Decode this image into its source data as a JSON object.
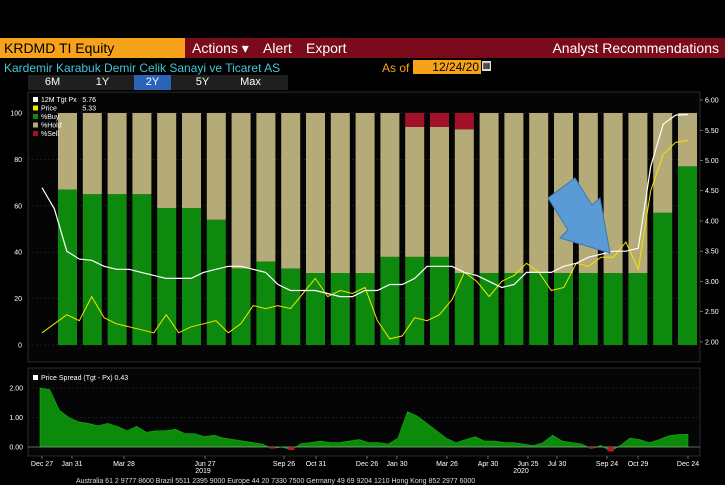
{
  "header": {
    "ticker": "KRDMD TI Equity",
    "menu": [
      "Actions ▾",
      "Alert",
      "Export"
    ],
    "function_title": "Analyst Recommendations",
    "security_name": "Kardemir Karabuk Demir Celik Sanayi ve Ticaret AS",
    "as_of_label": "As of",
    "as_of_date": "12/24/20",
    "calendar_icon": "calendar-icon"
  },
  "tabs": [
    {
      "label": "6M",
      "selected": false
    },
    {
      "label": "1Y",
      "selected": false
    },
    {
      "label": "2Y",
      "selected": true
    },
    {
      "label": "5Y",
      "selected": false
    },
    {
      "label": "Max",
      "selected": false
    }
  ],
  "colors": {
    "buy": "#0d8a0d",
    "hold": "#b5ab78",
    "sell": "#a3102a",
    "target": "#ffffff",
    "price": "#f5e400",
    "spread": "#0b8a0b",
    "menu_bar": "#7a0b1b",
    "ticker_bg": "#f7a21b"
  },
  "chart_data": [
    {
      "type": "bar",
      "left_axis": {
        "ticks": [
          "100",
          "80",
          "60",
          "40",
          "20",
          "0"
        ],
        "ylim": [
          0,
          100
        ]
      },
      "right_axis": {
        "ticks": [
          "6.00",
          "5.50",
          "5.00",
          "4.50",
          "4.00",
          "3.50",
          "3.00",
          "2.50",
          "2.00"
        ],
        "ylim": [
          1.8,
          6.05
        ]
      },
      "legend": [
        {
          "label": "12M Tgt Px",
          "value": "5.76"
        },
        {
          "label": "Price",
          "value": "5.33"
        },
        {
          "label": "%Buy",
          "value": ""
        },
        {
          "label": "%Hold",
          "value": ""
        },
        {
          "label": "%Sell",
          "value": ""
        }
      ],
      "stacked_bars": {
        "buy": [
          67,
          65,
          65,
          65,
          59,
          59,
          54,
          33,
          36,
          33,
          31,
          31,
          31,
          38,
          38,
          38,
          31,
          31,
          31,
          31,
          31,
          31,
          31,
          31,
          57,
          77
        ],
        "hold": [
          33,
          35,
          35,
          35,
          41,
          41,
          46,
          67,
          64,
          67,
          69,
          69,
          69,
          62,
          56,
          56,
          62,
          69,
          69,
          69,
          69,
          69,
          69,
          69,
          43,
          23
        ],
        "sell": [
          0,
          0,
          0,
          0,
          0,
          0,
          0,
          0,
          0,
          0,
          0,
          0,
          0,
          0,
          6,
          6,
          7,
          0,
          0,
          0,
          0,
          0,
          0,
          0,
          0,
          0
        ]
      },
      "series": [
        {
          "name": "12M Tgt Px",
          "values": [
            4.55,
            4.2,
            3.5,
            3.37,
            3.35,
            3.25,
            3.2,
            3.2,
            3.15,
            3.1,
            3.05,
            3.05,
            3.05,
            3.15,
            3.2,
            3.25,
            3.25,
            3.2,
            3.15,
            2.95,
            2.85,
            2.85,
            2.85,
            2.8,
            2.75,
            2.75,
            2.85,
            2.85,
            2.95,
            2.95,
            3.05,
            3.25,
            3.25,
            3.25,
            3.15,
            3.1,
            3.0,
            2.9,
            2.95,
            3.15,
            3.15,
            3.15,
            3.25,
            3.3,
            3.4,
            3.45,
            3.5,
            3.5,
            3.55,
            4.9,
            5.6,
            5.75,
            5.76
          ]
        },
        {
          "name": "Price",
          "values": [
            2.15,
            2.3,
            2.45,
            2.35,
            2.75,
            2.4,
            2.3,
            2.25,
            2.2,
            2.15,
            2.45,
            2.15,
            2.25,
            2.3,
            2.35,
            2.15,
            2.3,
            2.6,
            2.55,
            2.6,
            2.55,
            2.8,
            3.05,
            2.75,
            2.85,
            2.8,
            2.9,
            2.35,
            2.05,
            2.1,
            2.4,
            2.35,
            2.45,
            2.7,
            3.15,
            3.0,
            2.75,
            3.0,
            3.1,
            3.3,
            3.15,
            2.85,
            2.9,
            3.3,
            3.25,
            3.4,
            3.4,
            3.65,
            3.2,
            4.5,
            5.1,
            5.3,
            5.33
          ]
        }
      ]
    },
    {
      "type": "area",
      "legend": [
        {
          "label": "Price Spread (Tgt - Px)",
          "value": "0.43"
        }
      ],
      "y_ticks": [
        "2.00",
        "1.00",
        "0.00"
      ],
      "ylim": [
        -0.35,
        2.05
      ],
      "series": [
        {
          "name": "Price Spread (Tgt - Px)",
          "values": [
            2.0,
            1.95,
            1.25,
            1.0,
            0.85,
            0.8,
            0.72,
            0.8,
            0.7,
            0.55,
            0.7,
            0.5,
            0.55,
            0.55,
            0.6,
            0.45,
            0.45,
            0.35,
            0.4,
            0.3,
            0.25,
            0.2,
            0.15,
            0.1,
            -0.05,
            0.0,
            -0.1,
            0.12,
            0.15,
            0.2,
            0.15,
            0.15,
            0.2,
            0.25,
            0.15,
            0.15,
            0.1,
            0.3,
            1.2,
            1.05,
            0.8,
            0.55,
            0.3,
            0.15,
            0.25,
            0.35,
            0.2,
            0.2,
            0.15,
            0.15,
            0.1,
            0.05,
            0.15,
            0.4,
            0.2,
            0.15,
            0.1,
            -0.05,
            0.05,
            -0.15,
            0.05,
            0.3,
            0.25,
            0.15,
            0.25,
            0.38,
            0.42,
            0.43
          ]
        }
      ],
      "x_ticks": [
        "Dec 27",
        "Jan 31",
        "Mar 28",
        "Jun 27",
        "Sep 26",
        "Oct 31",
        "Dec 26",
        "Jan 30",
        "Mar 26",
        "Apr 30",
        "Jun 25",
        "Jul 30",
        "Sep 24",
        "Oct 29",
        "Dec 24"
      ],
      "year_labels": [
        "2019",
        "2020"
      ]
    }
  ],
  "footer_text": "Australia 61 2 9777 8600 Brazil 5511 2395 9000 Europe 44 20 7330 7500 Germany 49 69 9204 1210 Hong Kong 852 2977 6000"
}
